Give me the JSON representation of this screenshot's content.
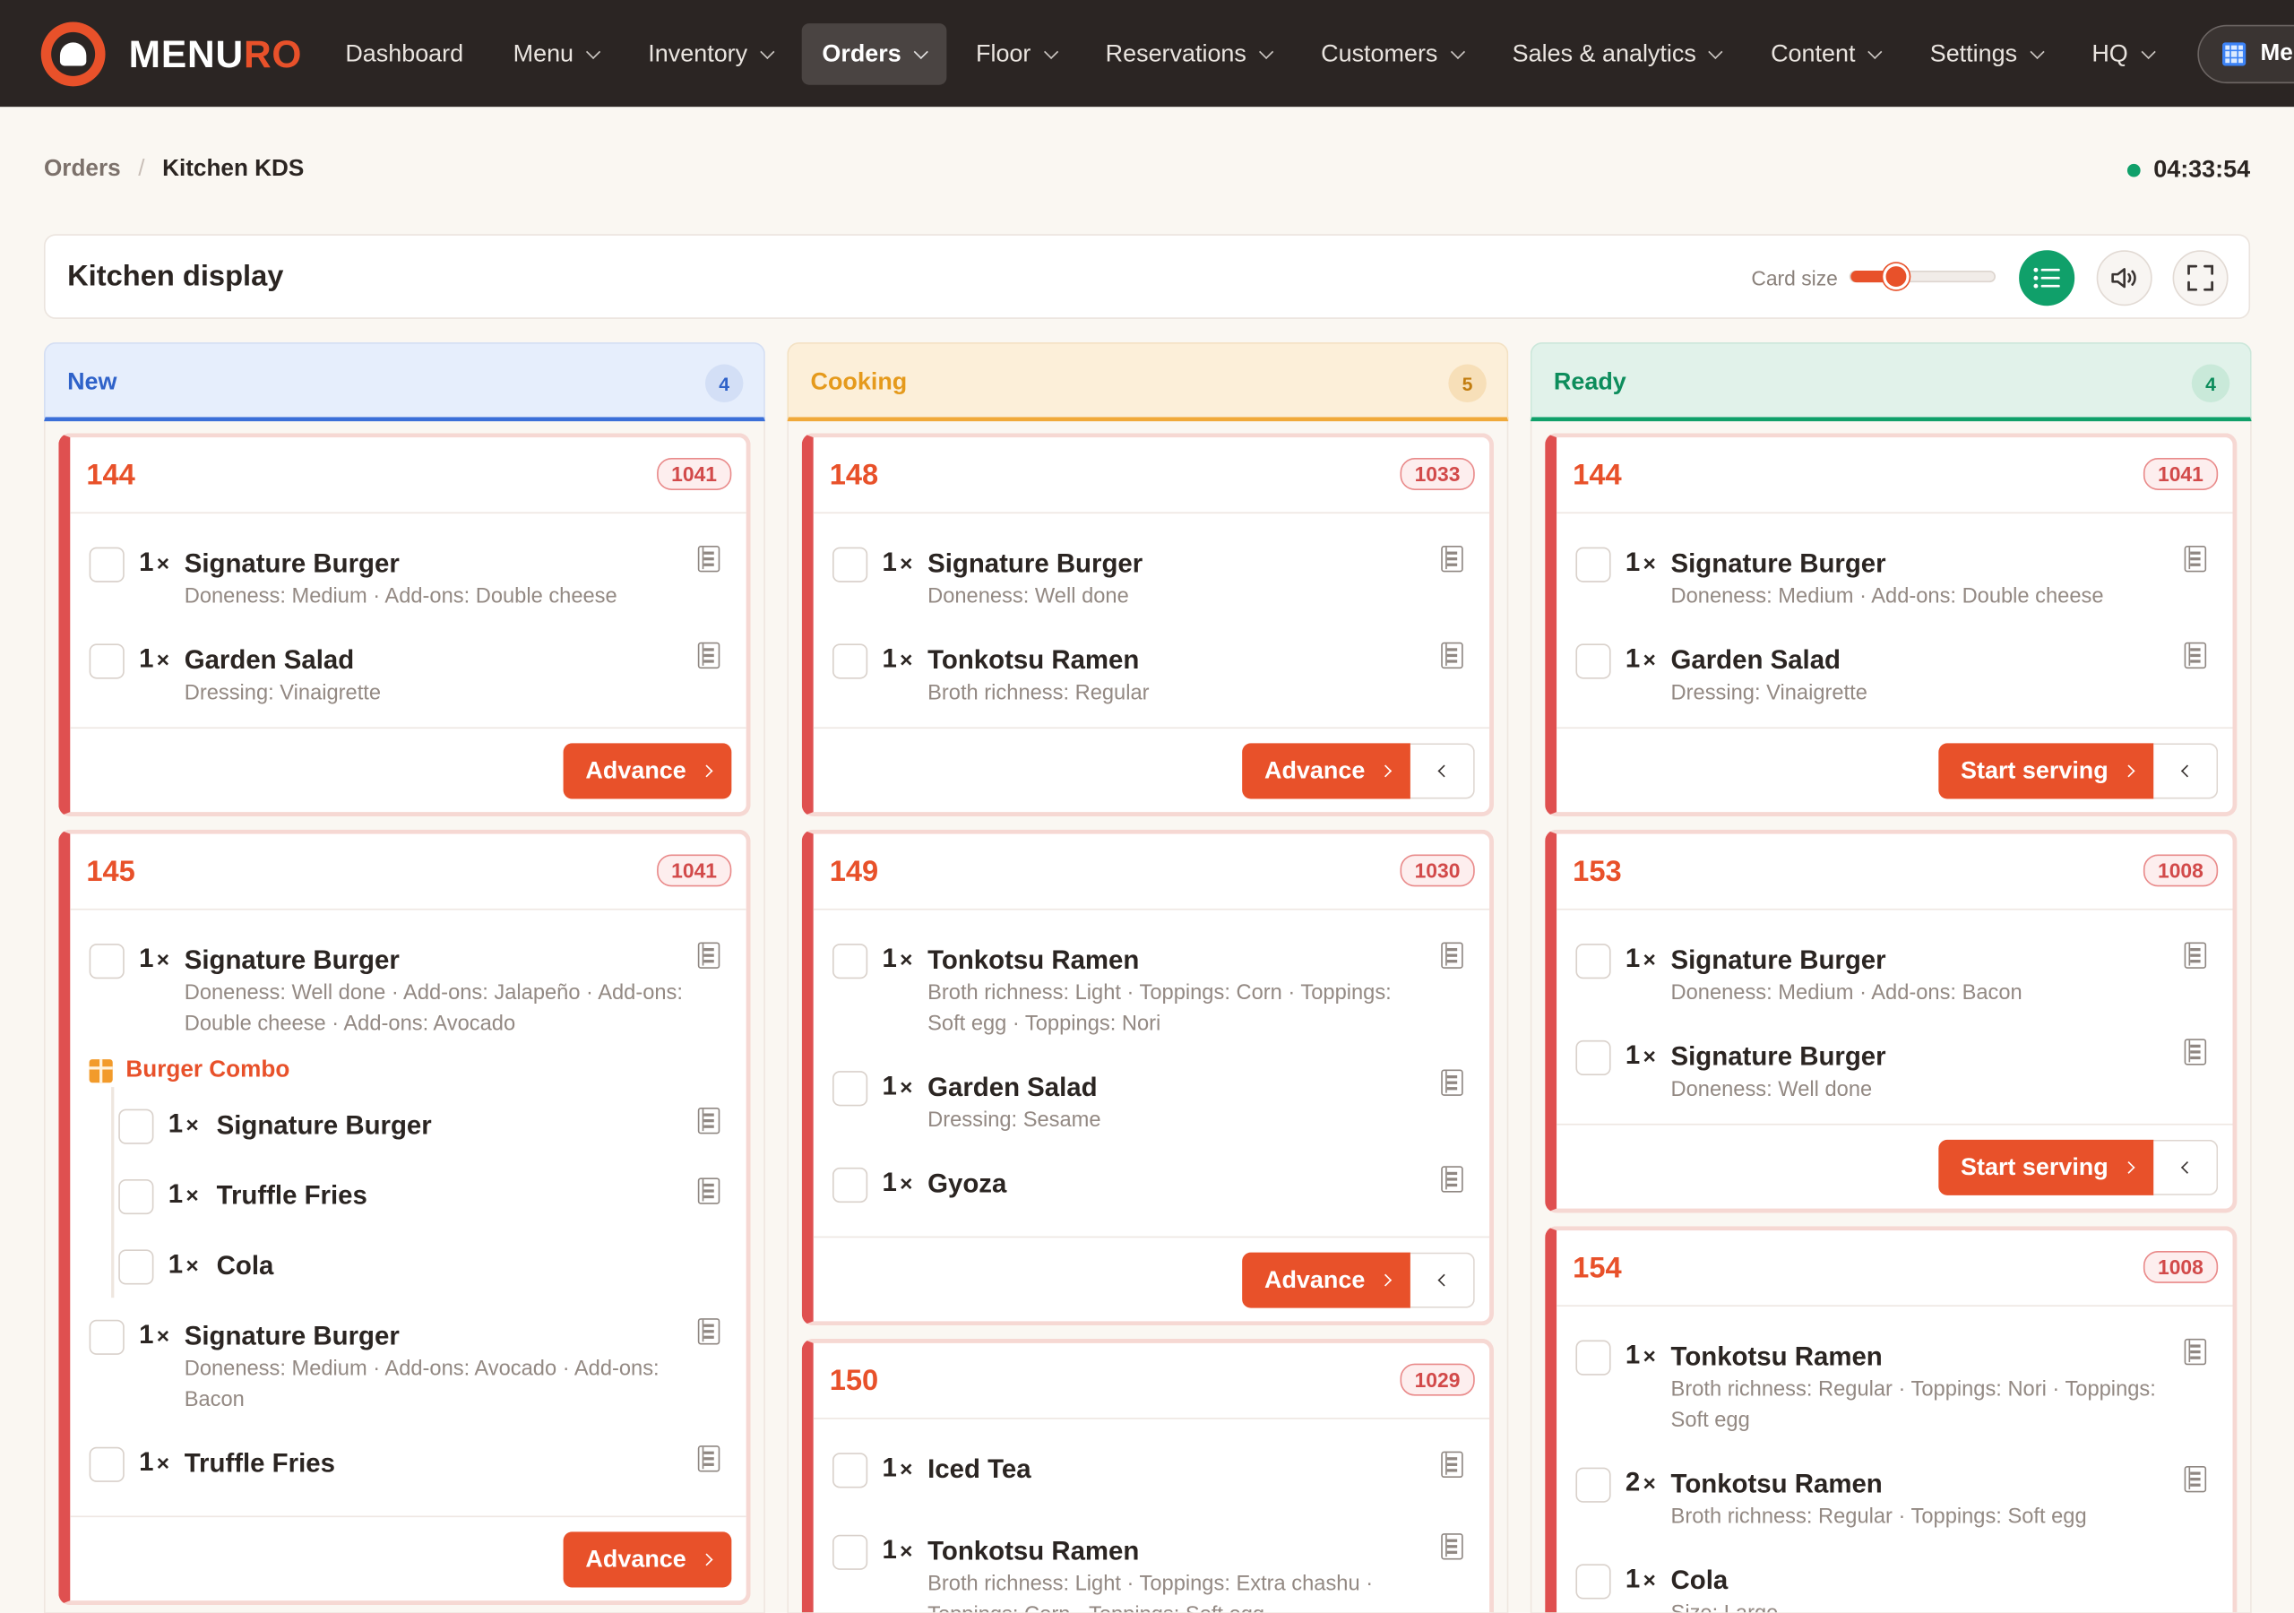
{
  "brand": {
    "part1": "MENU",
    "part2": "RO",
    "accent": "#e8512a"
  },
  "nav": [
    {
      "label": "Dashboard",
      "dropdown": false
    },
    {
      "label": "Menu",
      "dropdown": true
    },
    {
      "label": "Inventory",
      "dropdown": true
    },
    {
      "label": "Orders",
      "dropdown": true,
      "active": true
    },
    {
      "label": "Floor",
      "dropdown": true
    },
    {
      "label": "Reservations",
      "dropdown": true
    },
    {
      "label": "Customers",
      "dropdown": true
    },
    {
      "label": "Sales & analytics",
      "dropdown": true
    },
    {
      "label": "Content",
      "dropdown": true
    },
    {
      "label": "Settings",
      "dropdown": true
    },
    {
      "label": "HQ",
      "dropdown": true
    }
  ],
  "org_button": {
    "label": "Me"
  },
  "breadcrumb": {
    "parent": "Orders",
    "current": "Kitchen KDS"
  },
  "clock": "04:33:54",
  "toolbar": {
    "title": "Kitchen display",
    "card_size_label": "Card size",
    "card_size_value": 0.32
  },
  "columns": [
    {
      "key": "new",
      "title": "New",
      "count": "4",
      "color": "#3b6fd8",
      "orders": [
        {
          "number": "144",
          "tag": "1041",
          "items": [
            {
              "qty": "1",
              "name": "Signature Burger",
              "mods": "Doneness: Medium · Add-ons: Double cheese"
            },
            {
              "qty": "1",
              "name": "Garden Salad",
              "mods": "Dressing: Vinaigrette"
            }
          ],
          "action": "Advance",
          "back": false
        },
        {
          "number": "145",
          "tag": "1041",
          "items": [
            {
              "qty": "1",
              "name": "Signature Burger",
              "mods": "Doneness: Well done · Add-ons: Jalapeño · Add-ons: Double cheese · Add-ons: Avocado"
            }
          ],
          "combo": {
            "label": "Burger Combo",
            "items": [
              {
                "qty": "1",
                "name": "Signature Burger",
                "mods": ""
              },
              {
                "qty": "1",
                "name": "Truffle Fries",
                "mods": ""
              },
              {
                "qty": "1",
                "name": "Cola",
                "mods": "",
                "no_note": true
              }
            ]
          },
          "items_after": [
            {
              "qty": "1",
              "name": "Signature Burger",
              "mods": "Doneness: Medium · Add-ons: Avocado · Add-ons: Bacon"
            },
            {
              "qty": "1",
              "name": "Truffle Fries",
              "mods": ""
            }
          ],
          "action": "Advance",
          "back": false
        }
      ]
    },
    {
      "key": "cook",
      "title": "Cooking",
      "count": "5",
      "color": "#f0a93a",
      "orders": [
        {
          "number": "148",
          "tag": "1033",
          "items": [
            {
              "qty": "1",
              "name": "Signature Burger",
              "mods": "Doneness: Well done"
            },
            {
              "qty": "1",
              "name": "Tonkotsu Ramen",
              "mods": "Broth richness: Regular"
            }
          ],
          "action": "Advance",
          "back": true
        },
        {
          "number": "149",
          "tag": "1030",
          "items": [
            {
              "qty": "1",
              "name": "Tonkotsu Ramen",
              "mods": "Broth richness: Light · Toppings: Corn · Toppings: Soft egg · Toppings: Nori"
            },
            {
              "qty": "1",
              "name": "Garden Salad",
              "mods": "Dressing: Sesame"
            },
            {
              "qty": "1",
              "name": "Gyoza",
              "mods": ""
            }
          ],
          "action": "Advance",
          "back": true
        },
        {
          "number": "150",
          "tag": "1029",
          "items": [
            {
              "qty": "1",
              "name": "Iced Tea",
              "mods": ""
            },
            {
              "qty": "1",
              "name": "Tonkotsu Ramen",
              "mods": "Broth richness: Light · Toppings: Extra chashu · Toppings: Corn · Toppings: Soft egg"
            }
          ],
          "action": "",
          "back": false
        }
      ]
    },
    {
      "key": "ready",
      "title": "Ready",
      "count": "4",
      "color": "#10a06a",
      "orders": [
        {
          "number": "144",
          "tag": "1041",
          "items": [
            {
              "qty": "1",
              "name": "Signature Burger",
              "mods": "Doneness: Medium · Add-ons: Double cheese"
            },
            {
              "qty": "1",
              "name": "Garden Salad",
              "mods": "Dressing: Vinaigrette"
            }
          ],
          "action": "Start serving",
          "back": true
        },
        {
          "number": "153",
          "tag": "1008",
          "items": [
            {
              "qty": "1",
              "name": "Signature Burger",
              "mods": "Doneness: Medium · Add-ons: Bacon"
            },
            {
              "qty": "1",
              "name": "Signature Burger",
              "mods": "Doneness: Well done"
            }
          ],
          "action": "Start serving",
          "back": true
        },
        {
          "number": "154",
          "tag": "1008",
          "items": [
            {
              "qty": "1",
              "name": "Tonkotsu Ramen",
              "mods": "Broth richness: Regular · Toppings: Nori · Toppings: Soft egg"
            },
            {
              "qty": "2",
              "name": "Tonkotsu Ramen",
              "mods": "Broth richness: Regular · Toppings: Soft egg"
            },
            {
              "qty": "1",
              "name": "Cola",
              "mods": "Size: Large",
              "no_note": true
            }
          ],
          "action": "",
          "back": false
        }
      ]
    }
  ]
}
